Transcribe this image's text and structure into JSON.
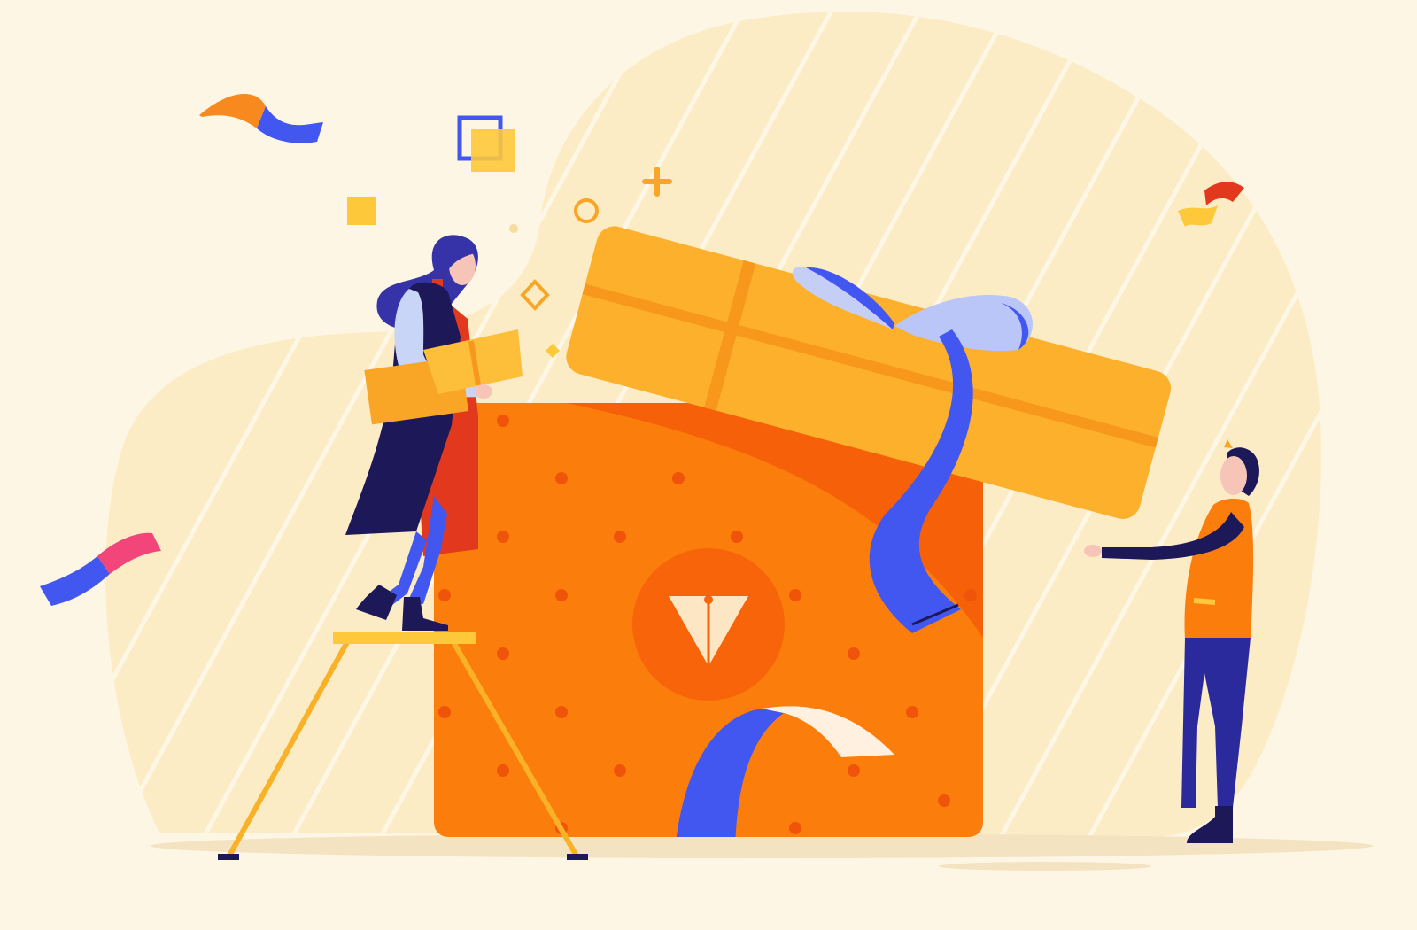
{
  "scene": {
    "description_visible_text": "",
    "colors": {
      "background": "#fdf6e4",
      "blob": "#fcecc6",
      "stripe": "#fff8e8",
      "box_orange": "#fb7d0c",
      "box_dark": "#f45a08",
      "lid_yellow": "#fdb02b",
      "lid_band": "#f7981c",
      "ribbon_blue": "#4257f0",
      "ribbon_light": "#b9c6f7",
      "navy": "#1d1858",
      "skin": "#f7c4b8",
      "red": "#e2381d",
      "pink": "#f2457a",
      "confetti_yellow": "#fdc93a",
      "ladder_yellow": "#f9b227"
    },
    "icons": [
      "gift-box",
      "gift-lid",
      "ribbon-bow",
      "ladder",
      "woman-figure",
      "man-figure",
      "confetti",
      "logo-chevron-icon"
    ]
  }
}
